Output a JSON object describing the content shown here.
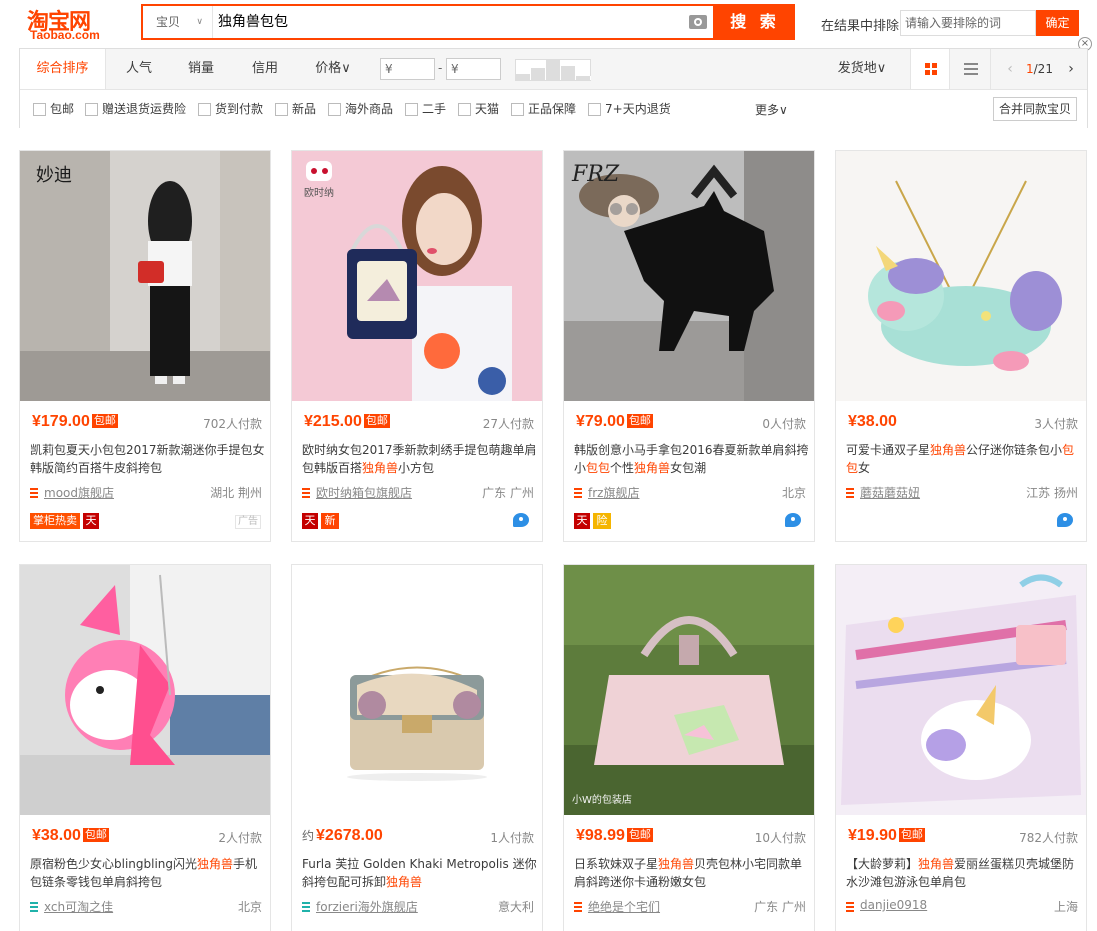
{
  "header": {
    "logo_cn": "淘宝网",
    "logo_en": "Taobao.com",
    "search_scope": "宝贝",
    "search_query": "独角兽包包",
    "search_button": "搜 索",
    "exclude_label": "在结果中排除",
    "exclude_placeholder": "请输入要排除的词",
    "exclude_button": "确定",
    "close_glyph": "×"
  },
  "sort": {
    "tabs": [
      "综合排序",
      "人气",
      "销量",
      "信用",
      "价格∨"
    ],
    "price_from": "¥",
    "price_to": "¥",
    "price_dash": "-",
    "location": "发货地∨",
    "page_current": "1",
    "page_total": "/21",
    "prev": "‹",
    "next": "›"
  },
  "filters": {
    "items": [
      "包邮",
      "赠送退货运费险",
      "货到付款",
      "新品",
      "海外商品",
      "二手",
      "天猫",
      "正品保障",
      "7+天内退货"
    ],
    "more": "更多∨",
    "merge": "合并同款宝贝"
  },
  "products": [
    {
      "price": "¥179.00",
      "approx": "",
      "baoyou": "包邮",
      "deals": "702人付款",
      "title_html": "凯莉包夏天小包包2017新款潮迷你手提包女韩版简约百搭牛皮斜挎包",
      "shop": "mood旗舰店",
      "loc": "湖北 荆州",
      "badges": [
        "掌柜热卖",
        "天"
      ],
      "ad": "广告",
      "ww": false,
      "pic_bg": "#d9d6d2"
    },
    {
      "price": "¥215.00",
      "approx": "",
      "baoyou": "包邮",
      "deals": "27人付款",
      "title_html": "欧时纳女包2017季新款刺绣手提包萌趣单肩包韩版百搭<em>独角兽</em>小方包",
      "shop": "欧时纳箱包旗舰店",
      "loc": "广东 广州",
      "badges": [
        "天",
        "新"
      ],
      "ad": "",
      "ww": true,
      "pic_bg": "#f2c7d3"
    },
    {
      "price": "¥79.00",
      "approx": "",
      "baoyou": "包邮",
      "deals": "0人付款",
      "title_html": "韩版创意小马手拿包2016春夏新款单肩斜挎小<em>包包</em>个性<em>独角兽</em>女包潮",
      "shop": "frz旗舰店",
      "loc": "北京",
      "badges": [
        "天",
        "险"
      ],
      "ad": "",
      "ww": true,
      "pic_bg": "#c9c9c9"
    },
    {
      "price": "¥38.00",
      "approx": "",
      "baoyou": "",
      "deals": "3人付款",
      "title_html": "可爱卡通双子星<em>独角兽</em>公仔迷你链条包小<em>包包</em>女",
      "shop": "蘑菇蘑菇妞",
      "loc": "江苏 扬州",
      "badges": [],
      "ad": "",
      "ww": true,
      "pic_bg": "#f8f6f4"
    },
    {
      "price": "¥38.00",
      "approx": "",
      "baoyou": "包邮",
      "deals": "2人付款",
      "title_html": "原宿粉色少女心blingbling闪光<em>独角兽</em>手机包链条零钱包单肩斜挎包",
      "shop": "xch可淘之佳",
      "loc": "北京",
      "badges": [],
      "ad": "",
      "ww": false,
      "pic_bg": "#dcdcdc"
    },
    {
      "price": "¥2678.00",
      "approx": "约",
      "baoyou": "",
      "deals": "1人付款",
      "title_html": "Furla 芙拉 Golden Khaki Metropolis 迷你斜挎包配可拆卸<em>独角兽</em>",
      "shop": "forzieri海外旗舰店",
      "loc": "意大利",
      "badges": [],
      "ad": "",
      "ww": false,
      "pic_bg": "#ffffff"
    },
    {
      "price": "¥98.99",
      "approx": "",
      "baoyou": "包邮",
      "deals": "10人付款",
      "title_html": "日系软妹双子星<em>独角兽</em>贝壳包林小宅同款单肩斜跨迷你卡通粉嫩女包",
      "shop": "绝绝是个宅们",
      "loc": "广东 广州",
      "badges": [],
      "ad": "",
      "ww": false,
      "pic_bg": "#5a7a3a"
    },
    {
      "price": "¥19.90",
      "approx": "",
      "baoyou": "包邮",
      "deals": "782人付款",
      "title_html": "【大龄萝莉】<em>独角兽</em>爱丽丝蛋糕贝壳城堡防水沙滩包游泳包单肩包",
      "shop": "danjie0918",
      "loc": "上海",
      "badges": [],
      "ad": "",
      "ww": false,
      "pic_bg": "#f4ecf6"
    }
  ],
  "colors": {
    "accent": "#ff4400"
  }
}
